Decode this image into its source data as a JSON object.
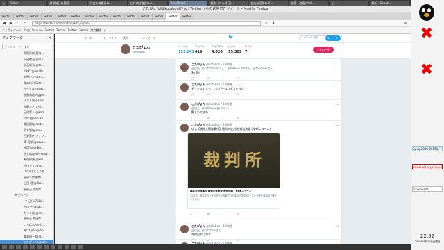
{
  "window_title": "こたぴょん(@kotabon)さん | Twitterからの返信付きツイート - Mozilla Firefox",
  "taskbar_items": [
    "Twitter",
    "最後前日の昇順",
    "大会では優秀の...",
    "これは勉強会のエ...",
    "TweetDeck",
    "最終: (つらぼ日(...",
    "自由な昭和の(2...",
    "検索 - 忠憲大学(I...",
    "こ",
    "最新 - Google..."
  ],
  "tabs": [
    "Twitter",
    "Twitter",
    "Twitter",
    "Twitter",
    "Twitter",
    "Twitter",
    "Twitter",
    "Twitter",
    "Twitter",
    "Twitter",
    "Twitter",
    "Twitter",
    "Twitter",
    "Twitter"
  ],
  "url": "https://twitter.com/kotabon/with_replies",
  "bookmarks": [
    "よく見るページ",
    "Blog",
    "Youtube",
    "Twitter",
    "Twitter",
    "Twitter",
    "Twitter",
    "論点整理",
    "ま"
  ],
  "sidebar": {
    "title": "ブックマーク",
    "search_placeholder": "ブックマークを検索",
    "folder_label": "グループ",
    "items": [
      "黒黒馬(米運ス...",
      "沢田敏治(@ma...",
      "立石隆弘(@tat...",
      "fnhK2@weath...",
      "岩田ひかりぼし...",
      "政本(hiroEcO...",
      "サイタル(@sait...",
      "祝島和(@Aggor...",
      "(Eさん(@papwl...",
      "水藤まさひろ(...",
      "日村嘉人(@kam...",
      "john(@kakuka...",
      "郷田健(@naits...",
      "鈴木誠(@sunu...",
      "日野家(ペンナン...",
      "澤 司郎(@kouk...",
      "MOT(@ohBo...",
      "水上雄(@ellysnag...",
      "有明修康(@kas...",
      "松山トマン(@...",
      "Uuke江とこうち...",
      "水藤ネ宗盛南(...",
      "山田 健(@Tab...",
      "水藤士 沙知郎...",
      "(リ)乙(1(7(1))...",
      "杉川 佐(@sat...",
      "カリン暗(@kn...",
      "水藤士 郷田郎...",
      "いちばんかm(s...",
      "みけ(@on@(ko...",
      "美濃園一郎(@...",
      "こたぴょん(@kot...",
      "櫻井太郎(@ke..."
    ]
  },
  "twitter": {
    "profile_name": "こたぴょん",
    "profile_handle": "@kotabon",
    "stats": [
      {
        "label": "ツイート",
        "value": "121,043"
      },
      {
        "label": "フォロー",
        "value": "419"
      },
      {
        "label": "フォロワー",
        "value": "4,020"
      },
      {
        "label": "いいね",
        "value": "15,309"
      },
      {
        "label": "リスト",
        "value": "7"
      }
    ],
    "nav": [
      "ホーム",
      "モーメント",
      "通知",
      "メッセージ"
    ],
    "search_placeholder": "キーワード検索",
    "tweet_button": "ツイート",
    "follow_button": "フォロー中",
    "tweets": [
      {
        "name": "こたぴょん",
        "handle": "@kotabon · 13時間",
        "lines": [
          "返信先: @kotabondeさん、@fukko2000さん、@tonorobiさん",
          "So Toi"
        ]
      },
      {
        "name": "こたぴょん",
        "handle": "@kotabon · 13時間",
        "lines": [
          "そうだなと言っていたがやはりダメだった"
        ]
      },
      {
        "name": "こたぴょん",
        "handle": "@kotabon · 13時間",
        "lines": [
          "返信先: @tamayaugaxilさん",
          "難しいですね..."
        ]
      },
      {
        "name": "こたぴょん",
        "handle": "@kotabon · 13時間",
        "lines": [
          "ゆし【福井大刑務事件】最判大会判決 通告決議 (NHKニュース)"
        ],
        "card": {
          "image_text": "裁判所",
          "title": "福井大刑務事件 最判大会判決 通告決議 | NHKニュース",
          "desc": "12年前、福井県の女子中学生が殺害された事件で懲役7年とした判決が最高裁で確定しました。"
        }
      },
      {
        "name": "こたぴょん",
        "handle": "@kotabon · 13時間",
        "lines": [
          "返信先: @kotabonさん",
          "今何日かにかな"
        ]
      },
      {
        "name": "こたぴょん",
        "handle": "@kotabon · 13時間",
        "lines": [
          "返信先: @non_lan_だ",
          "そういうとこなんだよいなので"
        ]
      }
    ]
  },
  "right_panel": {
    "labels": [
      "ky-wp2019-2019年",
      "select-sal-aryuying.d...",
      "screenShot"
    ]
  },
  "clock": {
    "time": "22:52",
    "date": "2019年9月30日金曜日"
  }
}
